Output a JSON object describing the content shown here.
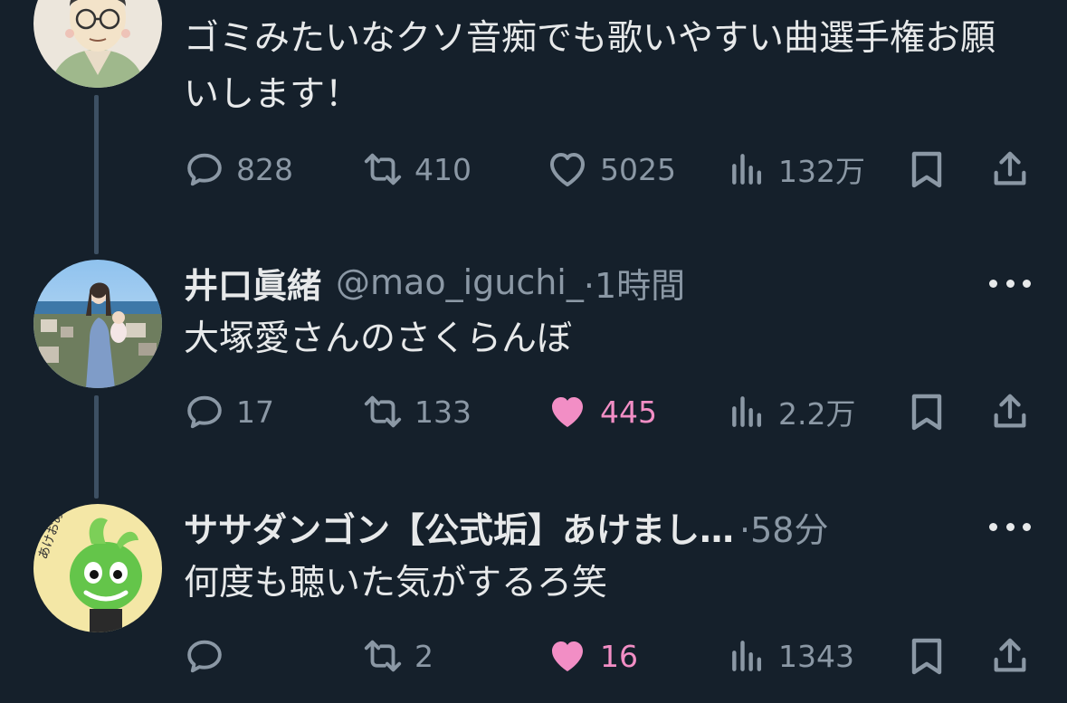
{
  "tweets": [
    {
      "text": "ゴミみたいなクソ音痴でも歌いやすい曲選手権お願いします！",
      "replies": "828",
      "retweets": "410",
      "likes": "5025",
      "views": "132万",
      "liked": false
    },
    {
      "name": "井口眞緒",
      "handle": "@mao_iguchi_",
      "time": "·1時間",
      "text": "大塚愛さんのさくらんぼ",
      "replies": "17",
      "retweets": "133",
      "likes": "445",
      "views": "2.2万",
      "liked": true
    },
    {
      "name": "ササダンゴン【公式垢】あけまし…",
      "time": "·58分",
      "text": "何度も聴いた気がするろ笑",
      "replies": "",
      "retweets": "2",
      "likes": "16",
      "views": "1343",
      "liked": true
    }
  ],
  "avatar_text": {
    "sasadangon": "あけおめ"
  },
  "icons": {
    "reply": "reply-icon",
    "retweet": "retweet-icon",
    "like": "heart-icon",
    "liked": "heart-filled-icon",
    "views": "analytics-icon",
    "bookmark": "bookmark-icon",
    "share": "share-icon",
    "more": "more-icon"
  },
  "colors": {
    "background": "#15202b",
    "text": "#e7e9ea",
    "muted": "#8b98a5",
    "like": "#f28ec5",
    "thread_line": "#3d5063"
  }
}
